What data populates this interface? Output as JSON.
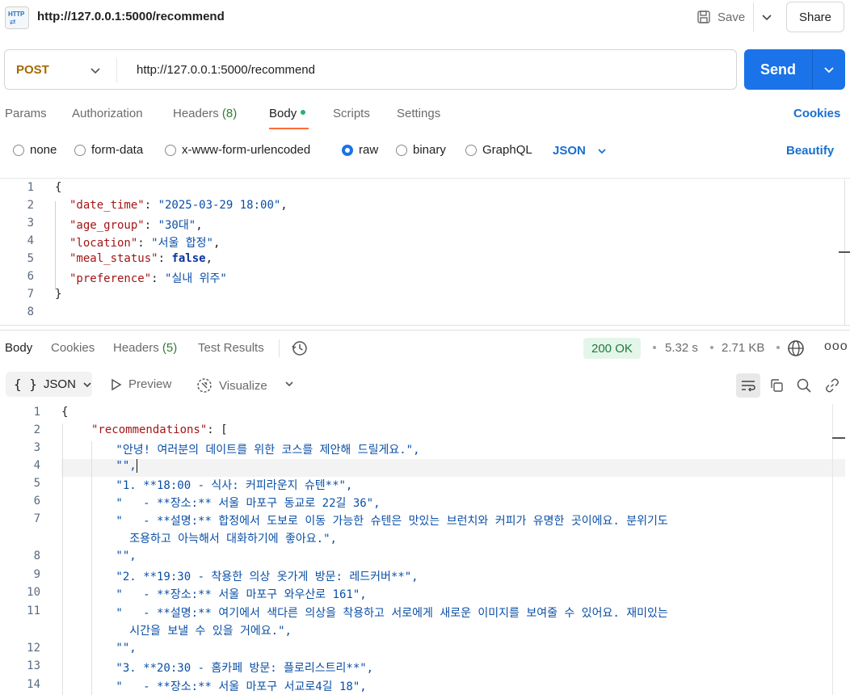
{
  "titlebar": {
    "badge_text": "HTTP",
    "title": "http://127.0.0.1:5000/recommend",
    "save_label": "Save",
    "share_label": "Share"
  },
  "request": {
    "method": "POST",
    "url": "http://127.0.0.1:5000/recommend",
    "send_label": "Send"
  },
  "req_tabs": {
    "params": "Params",
    "authorization": "Authorization",
    "headers": "Headers",
    "headers_count": "(8)",
    "body": "Body",
    "scripts": "Scripts",
    "settings": "Settings",
    "cookies": "Cookies"
  },
  "body_types": {
    "none": "none",
    "form_data": "form-data",
    "urlencoded": "x-www-form-urlencoded",
    "raw": "raw",
    "binary": "binary",
    "graphql": "GraphQL",
    "format": "JSON",
    "selected": "raw",
    "beautify": "Beautify"
  },
  "request_body": {
    "line_numbers": [
      "1",
      "2",
      "3",
      "4",
      "5",
      "6",
      "7",
      "8"
    ],
    "open_brace": "{",
    "close_brace": "}",
    "fields": [
      {
        "key": "\"date_time\"",
        "value": "\"2025-03-29 18:00\"",
        "trail": ","
      },
      {
        "key": "\"age_group\"",
        "value": "\"30대\"",
        "trail": ","
      },
      {
        "key": "\"location\"",
        "value": "\"서울 합정\"",
        "trail": ","
      },
      {
        "key": "\"meal_status\"",
        "value": "false",
        "trail": ","
      },
      {
        "key": "\"preference\"",
        "value": "\"실내 위주\"",
        "trail": ""
      }
    ]
  },
  "resp_tabs": {
    "body": "Body",
    "cookies": "Cookies",
    "headers": "Headers",
    "headers_count": "(5)",
    "test_results": "Test Results",
    "status": "200 OK",
    "time": "5.32 s",
    "size": "2.71 KB",
    "more": "ooo"
  },
  "resp_toolbar": {
    "format": "JSON",
    "braces": "{ }",
    "preview": "Preview",
    "visualize": "Visualize"
  },
  "response_body": {
    "lines": [
      {
        "n": "1",
        "text": "{"
      },
      {
        "n": "2",
        "key": "\"recommendations\"",
        "text": ": ["
      },
      {
        "n": "3",
        "text": "        \"안녕! 여러분의 데이트를 위한 코스를 제안해 드릴게요.\","
      },
      {
        "n": "4",
        "text": "        \"\","
      },
      {
        "n": "5",
        "text": "        \"1. **18:00 - 식사: 커피라운지 슈텐**\","
      },
      {
        "n": "6",
        "text": "        \"   - **장소:** 서울 마포구 동교로 22길 36\","
      },
      {
        "n": "7",
        "text": "        \"   - **설명:** 합정에서 도보로 이동 가능한 슈텐은 맛있는 브런치와 커피가 유명한 곳이에요. 분위기도"
      },
      {
        "n": "",
        "text": "          조용하고 아늑해서 대화하기에 좋아요.\","
      },
      {
        "n": "8",
        "text": "        \"\","
      },
      {
        "n": "9",
        "text": "        \"2. **19:30 - 착용한 의상 옷가게 방문: 레드커버**\","
      },
      {
        "n": "10",
        "text": "        \"   - **장소:** 서울 마포구 와우산로 161\","
      },
      {
        "n": "11",
        "text": "        \"   - **설명:** 여기에서 색다른 의상을 착용하고 서로에게 새로운 이미지를 보여줄 수 있어요. 재미있는"
      },
      {
        "n": "",
        "text": "          시간을 보낼 수 있을 거에요.\","
      },
      {
        "n": "12",
        "text": "        \"\","
      },
      {
        "n": "13",
        "text": "        \"3. **20:30 - 홈카페 방문: 플로리스트리**\","
      },
      {
        "n": "14",
        "text": "        \"   - **장소:** 서울 마포구 서교로4길 18\","
      }
    ]
  },
  "colors": {
    "accent": "#1a73e8",
    "method": "#a56a00",
    "tab_underline": "#ff6c37",
    "status_bg": "#e4f5ea",
    "status_text": "#1e7a3e"
  }
}
